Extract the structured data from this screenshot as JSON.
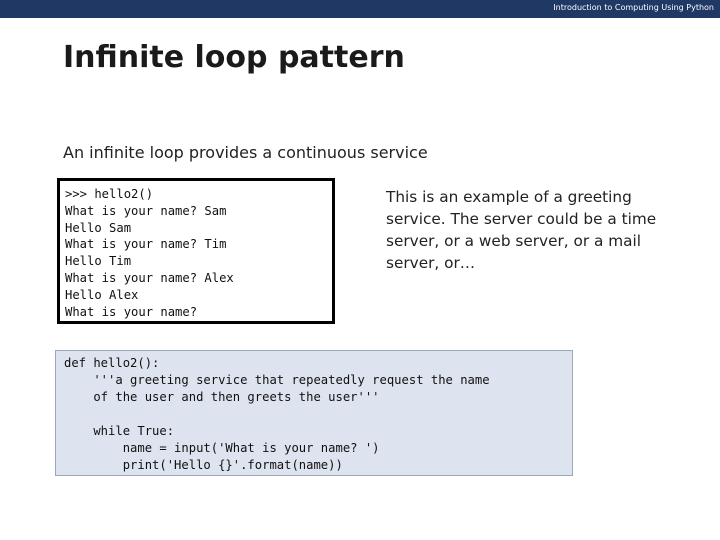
{
  "header": {
    "course_title": "Introduction to Computing Using Python"
  },
  "slide": {
    "title": "Infinite loop pattern",
    "subtitle": "An infinite loop provides a continuous service"
  },
  "terminal": {
    "lines": [
      ">>> hello2()",
      "What is your name? Sam",
      "Hello Sam",
      "What is your name? Tim",
      "Hello Tim",
      "What is your name? Alex",
      "Hello Alex",
      "What is your name?"
    ]
  },
  "description": {
    "lines": [
      "This is an example of a greeting",
      "service. The server could be a time",
      "server,  or a web server, or a mail",
      "server, or…"
    ]
  },
  "code": {
    "lines": [
      "def hello2():",
      "    '''a greeting service that repeatedly request the name",
      "    of the user and then greets the user'''",
      "",
      "    while True:",
      "        name = input('What is your name? ')",
      "        print('Hello {}'.format(name))"
    ]
  },
  "colors": {
    "header_bar": "#1f3864",
    "code_background": "#dde3ef",
    "terminal_border": "#000000"
  }
}
